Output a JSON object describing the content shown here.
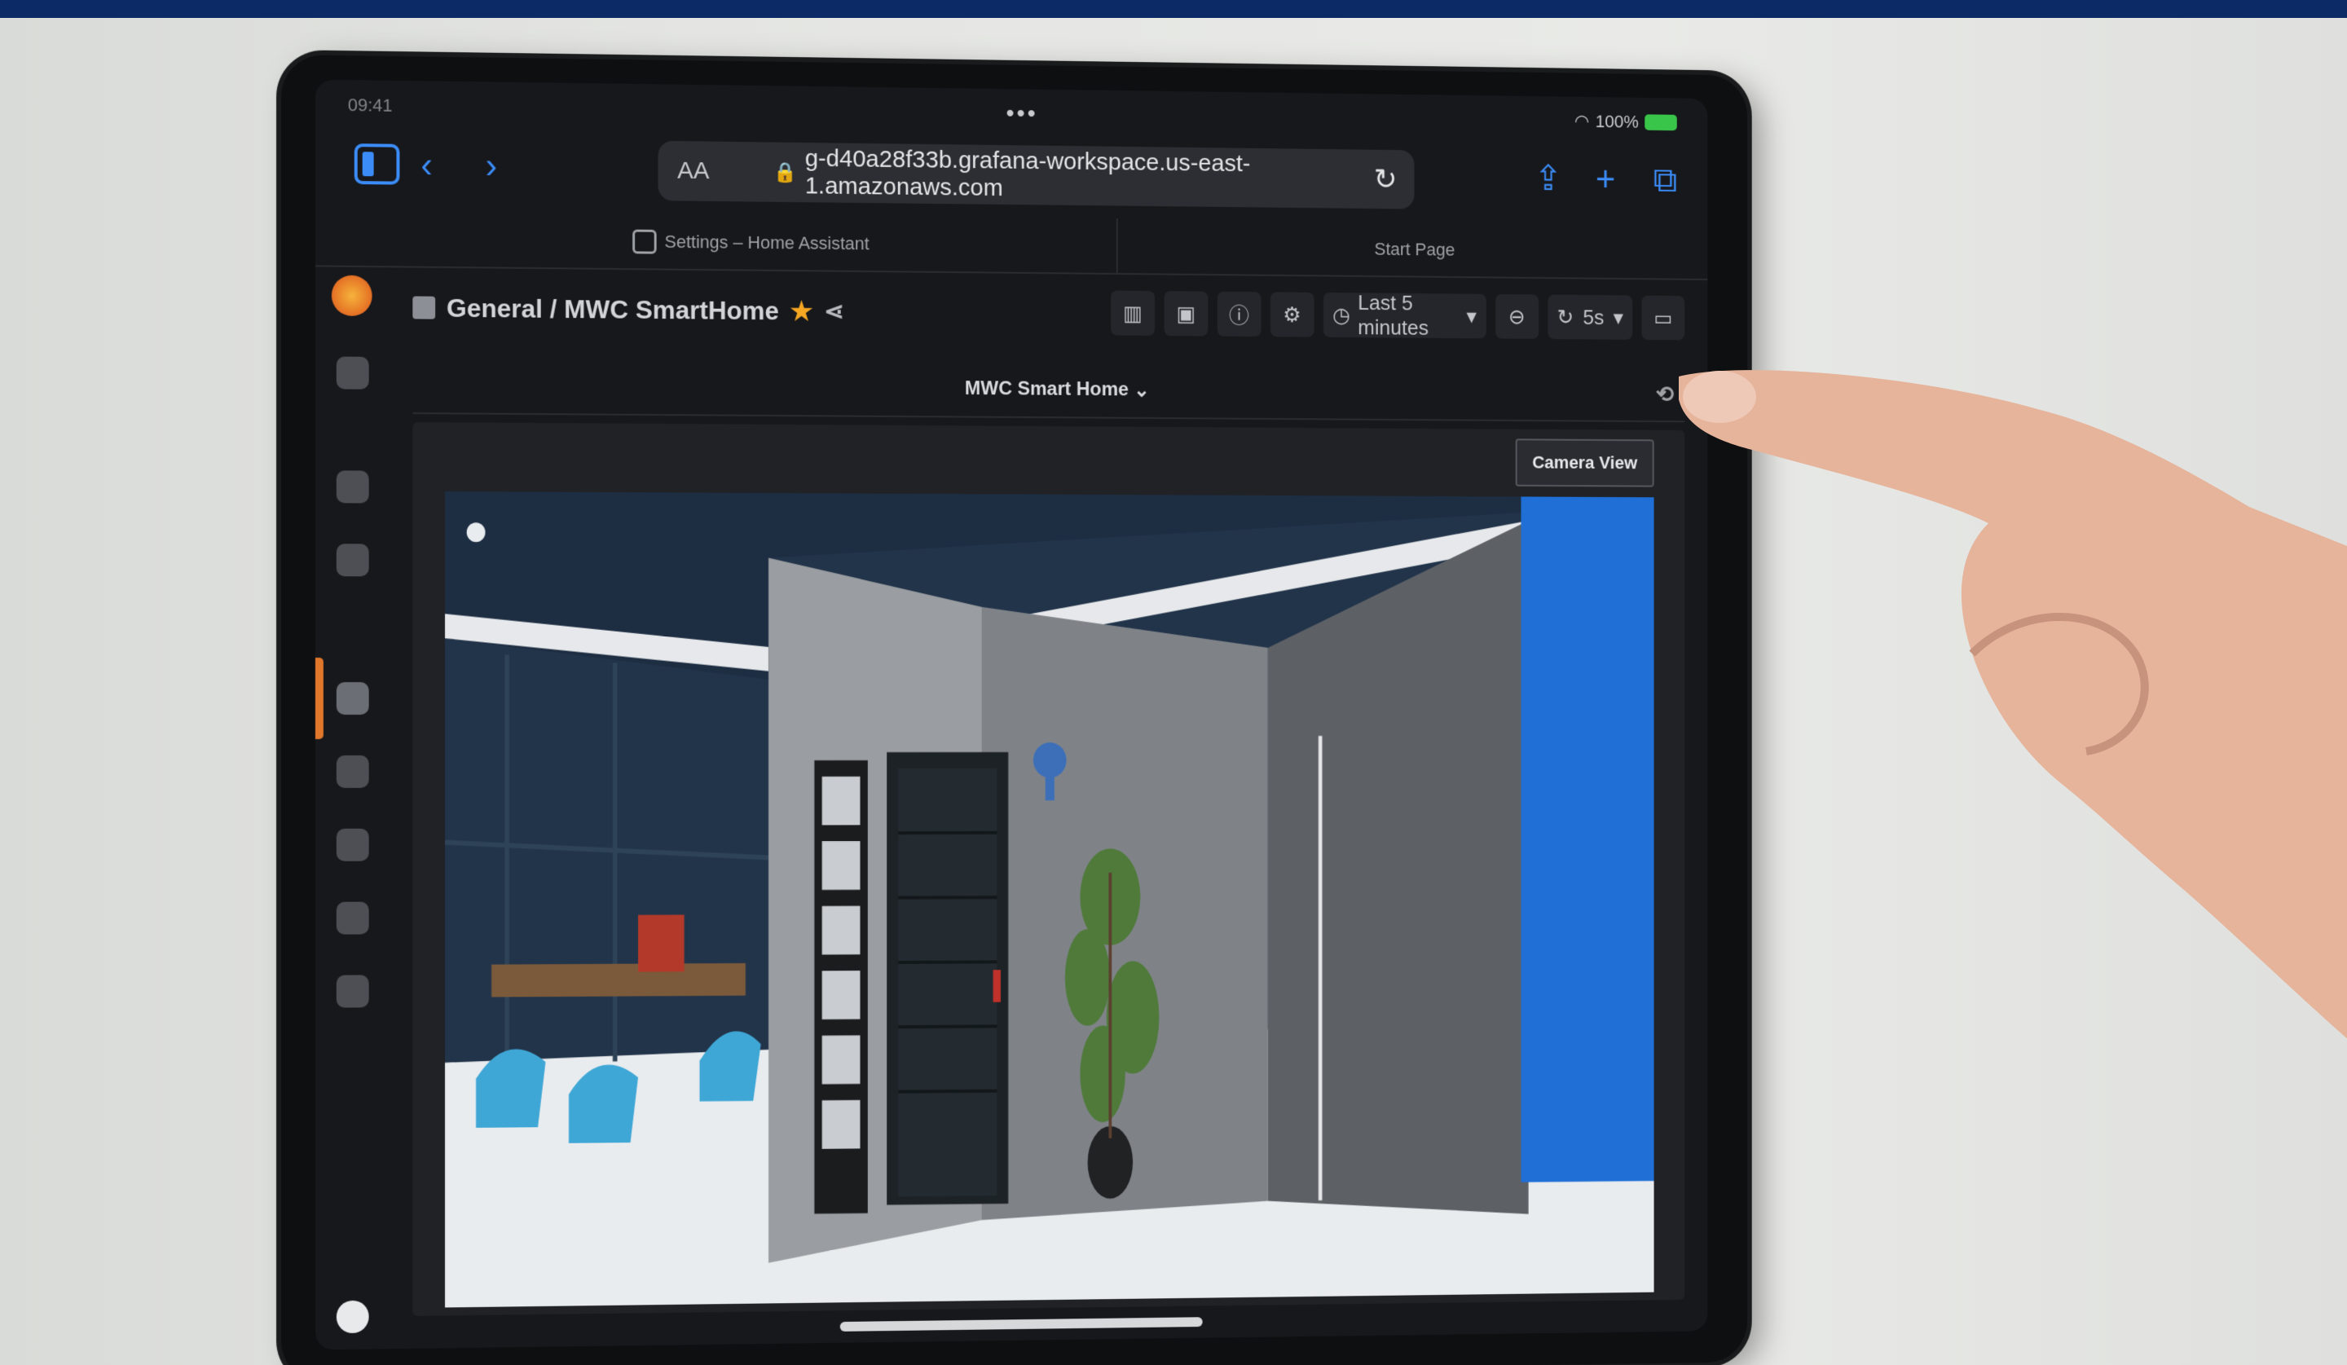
{
  "status": {
    "time": "09:41",
    "wifi_icon": "wifi-icon",
    "battery": "100%",
    "battery_color": "#39c54a",
    "menu_dots": "•••"
  },
  "browser": {
    "text_size_label": "AA",
    "url": "g-d40a28f33b.grafana-workspace.us-east-1.amazonaws.com",
    "tabs": [
      {
        "label": "Settings – Home Assistant"
      },
      {
        "label": "Start Page"
      }
    ],
    "accent_color": "#3b8cf7"
  },
  "dashboard": {
    "breadcrumb": "General / MWC SmartHome",
    "time_range": "Last 5 minutes",
    "refresh_interval": "5s",
    "variable_label": "MWC Smart Home",
    "panel_button": "Camera View"
  },
  "icons": {
    "sidebar": "sidebar-icon",
    "back": "chevron-left-icon",
    "forward": "chevron-right-icon",
    "share": "share-icon",
    "new_tab": "plus-icon",
    "tabs": "tabs-icon",
    "reload": "reload-icon",
    "star": "star-icon",
    "clock": "clock-icon",
    "zoom_out": "zoom-out-icon",
    "refresh": "refresh-icon",
    "tv_mode": "monitor-icon"
  }
}
